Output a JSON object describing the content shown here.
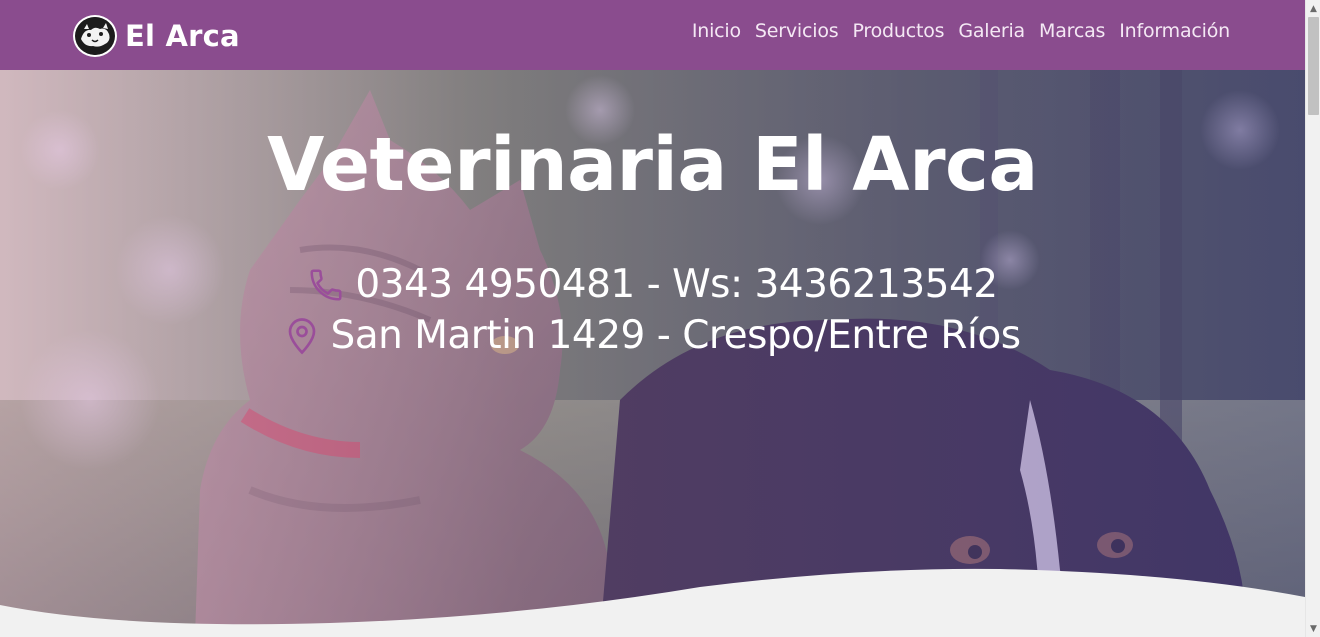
{
  "brand": {
    "name": "El Arca",
    "logo_icon": "animals-logo-icon"
  },
  "nav": {
    "items": [
      "Inicio",
      "Servicios",
      "Productos",
      "Galeria",
      "Marcas",
      "Información"
    ]
  },
  "hero": {
    "title": "Veterinaria El Arca",
    "phone_text": "0343 4950481 - Ws: 3436213542",
    "address_text": "San Martin 1429 - Crespo/Entre Ríos",
    "phone_icon": "phone-icon",
    "address_icon": "map-pin-icon",
    "accent_color": "#8a4c8e"
  },
  "scrollbar": {
    "up": "▲",
    "down": "▼"
  }
}
